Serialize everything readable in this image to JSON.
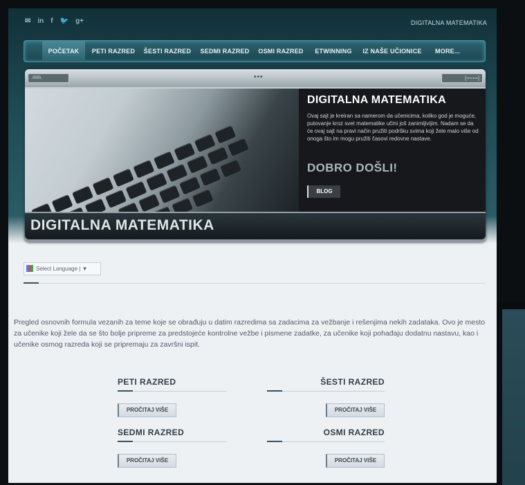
{
  "social": [
    "✉",
    "in",
    "f",
    "🐦",
    "g+"
  ],
  "site_tag": "DIGITALNA MATEMATIKA",
  "nav": [
    "POČETAK",
    "PETI RAZRED",
    "ŠESTI RAZRED",
    "SEDMI RAZRED",
    "OSMI RAZRED",
    "ETWINNING",
    "IZ NAŠE UČIONICE",
    "MORE..."
  ],
  "hero": {
    "title": "DIGITALNA MATEMATIKA",
    "description": "Ovaj sajt je kreiran sa namerom da učenicima, koliko god je moguće, putovanje kroz svet matematike učini još zanimljivijim. Nadam se da će ovaj sajt na pravi način pružiti podršku svima koji žele malo više od onoga što im mogu pružiti časovi redovne nastave.",
    "welcome": "DOBRO DOŠLI!",
    "blog_button": "BLOG",
    "caption": "DIGITALNA MATEMATIKA"
  },
  "language": "Select Language | ▼",
  "intro": "Pregled osnovnih formula vezanih za teme koje se obrađuju u datim razredima sa zadacima za vežbanje i rešenjima nekih zadataka. Ovo je mesto za učenike koji žele da se što bolje pripreme za predstojeće kontrolne vežbe i pismene zadatke, za učenike koji pohađaju dodatnu nastavu, kao i učenike osmog razreda koji se pripremaju za završni ispit.",
  "sections": [
    {
      "title": "PETI RAZRED",
      "button": "PROČITAJ VIŠE"
    },
    {
      "title": "ŠESTI RAZRED",
      "button": "PROČITAJ VIŠE"
    },
    {
      "title": "SEDMI RAZRED",
      "button": "PROČITAJ VIŠE"
    },
    {
      "title": "OSMI RAZRED",
      "button": "PROČITAJ VIŠE"
    }
  ],
  "colors": {
    "nav_bg": "#1b4550",
    "accent": "#34505c"
  }
}
